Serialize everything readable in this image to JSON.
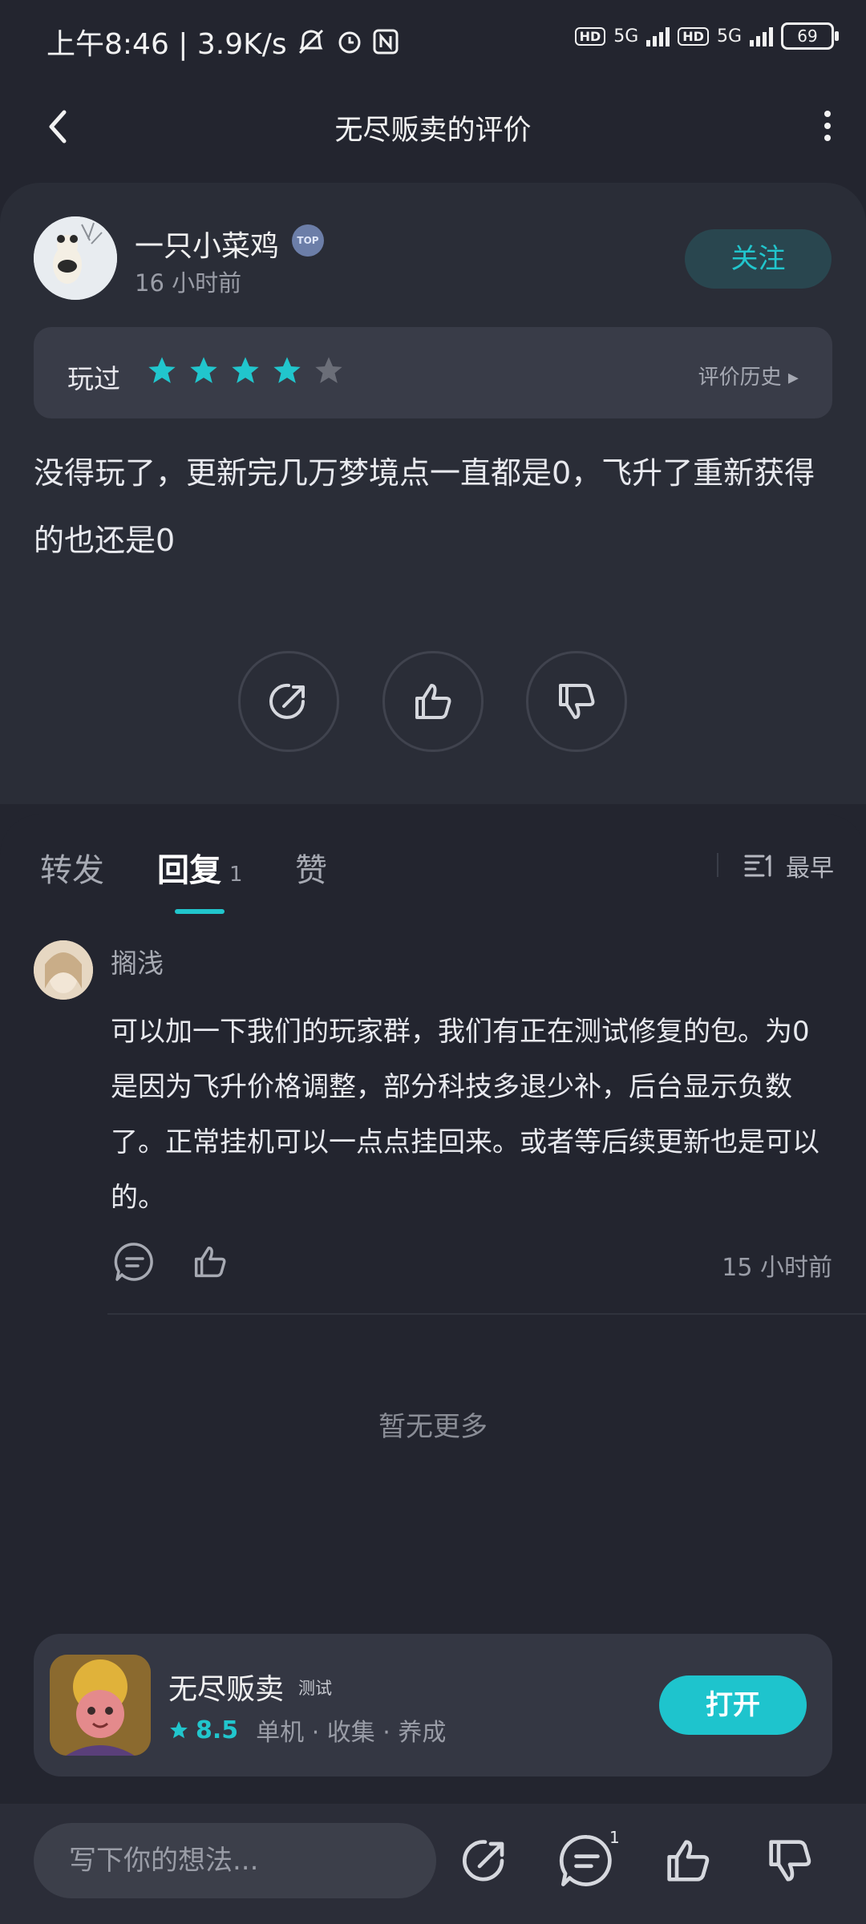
{
  "status_bar": {
    "time_speed": "上午8:46 | 3.9K/s",
    "hd1": "HD",
    "net1": "5G",
    "hd2": "HD",
    "net2": "5G",
    "battery": "69"
  },
  "header": {
    "title": "无尽贩卖的评价"
  },
  "review": {
    "author": "一只小菜鸡",
    "badge": "TOP",
    "time": "16 小时前",
    "follow_label": "关注",
    "played_label": "玩过",
    "rating": 4,
    "rating_max": 5,
    "history_label": "评价历史 ▸",
    "text": "没得玩了，更新完几万梦境点一直都是0，飞升了重新获得的也还是0"
  },
  "tabs": [
    {
      "label": "转发"
    },
    {
      "label": "回复",
      "count": "1"
    },
    {
      "label": "赞"
    }
  ],
  "sort_label": "最早",
  "reply": {
    "author": "搁浅",
    "text": "可以加一下我们的玩家群，我们有正在测试修复的包。为0是因为飞升价格调整，部分科技多退少补，后台显示负数了。正常挂机可以一点点挂回来。或者等后续更新也是可以的。",
    "time": "15 小时前"
  },
  "no_more": "暂无更多",
  "game": {
    "name": "无尽贩卖",
    "tag": "测试",
    "score": "8.5",
    "genres": "单机 · 收集 · 养成",
    "open_label": "打开"
  },
  "bottom_bar": {
    "placeholder": "写下你的想法...",
    "comment_count": "1"
  },
  "colors": {
    "accent": "#21c6cd",
    "background": "#23252f",
    "card": "#2a2d37"
  }
}
